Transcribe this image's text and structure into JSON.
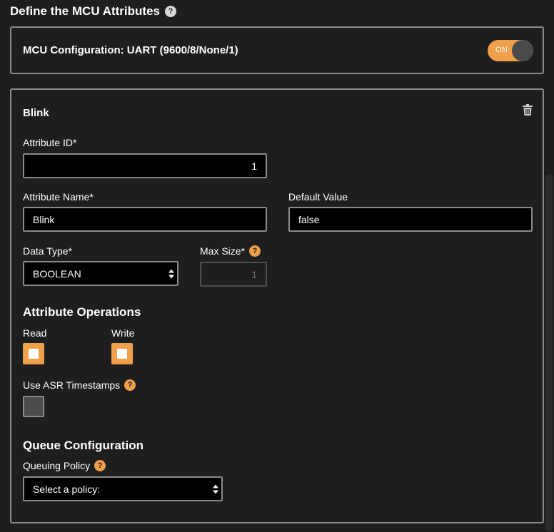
{
  "header": {
    "title": "Define the MCU Attributes"
  },
  "mcu": {
    "label": "MCU Configuration: UART (9600/8/None/1)",
    "toggle_label": "ON"
  },
  "attribute": {
    "title": "Blink",
    "id_label": "Attribute ID*",
    "id_value": "1",
    "name_label": "Attribute Name*",
    "name_value": "Blink",
    "default_label": "Default Value",
    "default_value": "false",
    "type_label": "Data Type*",
    "type_value": "BOOLEAN",
    "maxsize_label": "Max Size*",
    "maxsize_value": "1"
  },
  "operations": {
    "title": "Attribute Operations",
    "read_label": "Read",
    "write_label": "Write",
    "read_checked": true,
    "write_checked": true,
    "asr_label": "Use ASR Timestamps",
    "asr_checked": false
  },
  "queue": {
    "title": "Queue Configuration",
    "policy_label": "Queuing Policy",
    "policy_value": "Select a policy:"
  },
  "colors": {
    "accent": "#f0a04b",
    "background": "#1e1e1f",
    "border": "#8b8b8b",
    "input_bg": "#000000"
  }
}
